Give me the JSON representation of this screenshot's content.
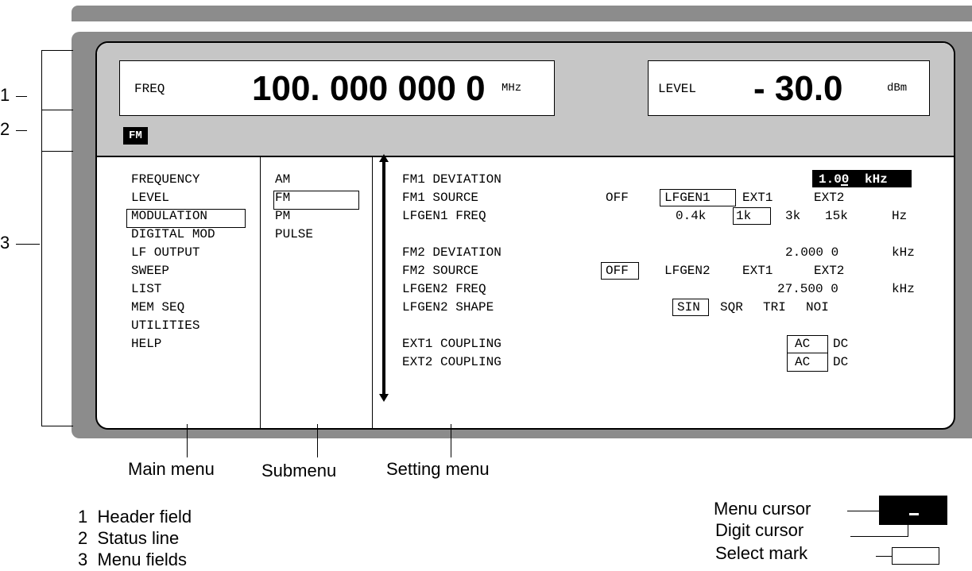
{
  "header": {
    "freq_label": "FREQ",
    "freq_value": "100. 000 000 0",
    "freq_unit": "MHz",
    "level_label": "LEVEL",
    "level_value": "- 30.0",
    "level_unit": "dBm"
  },
  "status": {
    "badge": "FM"
  },
  "main_menu": [
    "FREQUENCY",
    "LEVEL",
    "MODULATION",
    "DIGITAL MOD",
    "LF OUTPUT",
    "SWEEP",
    "LIST",
    "MEM SEQ",
    "UTILITIES",
    "HELP"
  ],
  "submenu": [
    "AM",
    "FM",
    "PM",
    "PULSE"
  ],
  "settings": {
    "labels": [
      "FM1 DEVIATION",
      "FM1 SOURCE",
      "LFGEN1 FREQ",
      "FM2 DEVIATION",
      "FM2 SOURCE",
      "LFGEN2 FREQ",
      "LFGEN2 SHAPE",
      "EXT1 COUPLING",
      "EXT2 COUPLING"
    ],
    "fm1_deviation_value": "1.00",
    "fm1_deviation_unit": "kHz",
    "fm1_source_options": [
      "OFF",
      "LFGEN1",
      "EXT1",
      "EXT2"
    ],
    "lfgen1_freq_options": [
      "0.4k",
      "1k",
      "3k",
      "15k"
    ],
    "lfgen1_freq_unit": "Hz",
    "fm2_deviation_value": "2.000 0",
    "fm2_deviation_unit": "kHz",
    "fm2_source_options": [
      "OFF",
      "LFGEN2",
      "EXT1",
      "EXT2"
    ],
    "lfgen2_freq_value": "27.500 0",
    "lfgen2_freq_unit": "kHz",
    "lfgen2_shape_options": [
      "SIN",
      "SQR",
      "TRI",
      "NOI"
    ],
    "ext1_coupling_options": [
      "AC",
      "DC"
    ],
    "ext2_coupling_options": [
      "AC",
      "DC"
    ]
  },
  "callouts": {
    "numbers": [
      "1",
      "2",
      "3"
    ],
    "main_menu": "Main menu",
    "submenu": "Submenu",
    "setting_menu": "Setting menu"
  },
  "legend_left": [
    "1  Header field",
    "2  Status line",
    "3  Menu fields"
  ],
  "legend_right": {
    "menu_cursor": "Menu cursor",
    "digit_cursor": "Digit cursor",
    "select_mark": "Select mark"
  }
}
